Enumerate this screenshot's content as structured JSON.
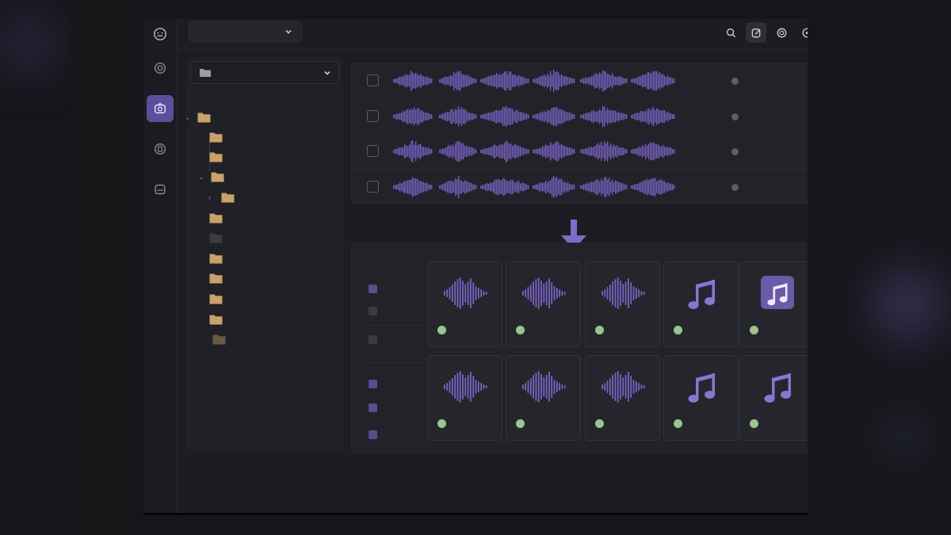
{
  "colors": {
    "accent": "#6f5fb6",
    "waveform": "#7a63c8",
    "folder": "#c9a266",
    "folder_dark": "#3b3c42",
    "status_ok": "#9bc48e",
    "app_bg": "#1c1d22",
    "panel_bg": "#222328"
  },
  "rail": {
    "items": [
      {
        "icon": "face-icon",
        "label": ""
      },
      {
        "icon": "history-icon",
        "label": ""
      },
      {
        "icon": "camera-icon",
        "label": "",
        "active": true
      },
      {
        "icon": "tag-icon",
        "label": ""
      },
      {
        "icon": "inbox-icon",
        "label": ""
      }
    ]
  },
  "topbar": {
    "breadcrumb": "",
    "tools": [
      {
        "icon": "search-icon"
      },
      {
        "icon": "edit-icon",
        "active": true
      },
      {
        "icon": "refresh-icon"
      },
      {
        "icon": "settings-icon"
      }
    ]
  },
  "tree": {
    "select_label": "",
    "nodes": [
      {
        "label": "",
        "expanded": true,
        "type": "folder"
      },
      {
        "label": "",
        "type": "folder"
      },
      {
        "label": "",
        "type": "folder"
      },
      {
        "label": "",
        "expanded": true,
        "type": "folder"
      },
      {
        "label": "",
        "collapsed": true,
        "type": "folder"
      },
      {
        "label": "",
        "type": "folder"
      },
      {
        "label": "",
        "type": "folder-dark"
      },
      {
        "label": "",
        "type": "folder"
      },
      {
        "label": "",
        "type": "folder"
      },
      {
        "label": "",
        "type": "folder"
      },
      {
        "label": "",
        "type": "folder"
      },
      {
        "label": "",
        "type": "folder-dim"
      }
    ]
  },
  "waveform_list": {
    "rows": [
      {
        "checked": false,
        "meta": ""
      },
      {
        "checked": false,
        "meta": ""
      },
      {
        "checked": false,
        "meta": ""
      },
      {
        "checked": false,
        "meta": ""
      }
    ]
  },
  "results": {
    "title": "",
    "filters": [
      {
        "label": "",
        "on": true
      },
      {
        "label": "",
        "on": false
      },
      {
        "label": "",
        "on": false
      },
      {
        "label": "",
        "on": true
      },
      {
        "label": "",
        "on": true
      },
      {
        "label": "",
        "on": true
      }
    ],
    "tiles": [
      {
        "icon": "waveform-icon",
        "label": ""
      },
      {
        "icon": "waveform-icon",
        "label": ""
      },
      {
        "icon": "waveform-icon",
        "label": ""
      },
      {
        "icon": "music-note-icon",
        "label": ""
      },
      {
        "icon": "music-note-badge-icon",
        "label": ""
      },
      {
        "icon": "waveform-icon",
        "label": ""
      },
      {
        "icon": "waveform-icon",
        "label": ""
      },
      {
        "icon": "waveform-icon",
        "label": ""
      },
      {
        "icon": "music-note-icon",
        "label": ""
      },
      {
        "icon": "music-note-icon",
        "label": ""
      }
    ]
  }
}
